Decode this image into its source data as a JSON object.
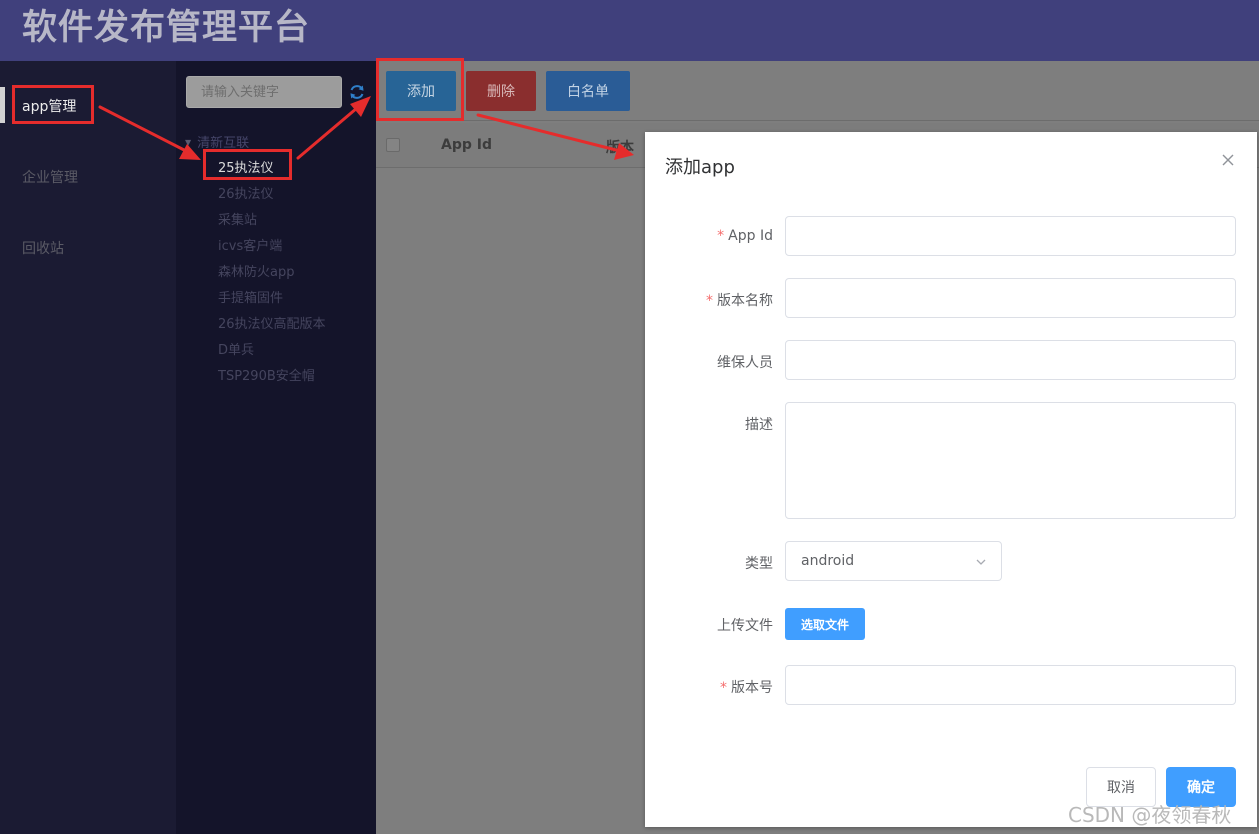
{
  "header": {
    "title": "软件发布管理平台"
  },
  "left_nav": {
    "items": [
      {
        "label": "app管理"
      },
      {
        "label": "企业管理"
      },
      {
        "label": "回收站"
      }
    ]
  },
  "tree": {
    "search_placeholder": "请输入关键字",
    "root_label": "清新互联",
    "items": [
      {
        "label": "25执法仪"
      },
      {
        "label": "26执法仪"
      },
      {
        "label": "采集站"
      },
      {
        "label": "icvs客户端"
      },
      {
        "label": "森林防火app"
      },
      {
        "label": "手提箱固件"
      },
      {
        "label": "26执法仪高配版本"
      },
      {
        "label": "D单兵"
      },
      {
        "label": "TSP290B安全帽"
      }
    ]
  },
  "toolbar": {
    "add_label": "添加",
    "delete_label": "删除",
    "whitelist_label": "白名单"
  },
  "table": {
    "columns": [
      "App Id",
      "版本"
    ]
  },
  "dialog": {
    "title": "添加app",
    "fields": {
      "app_id_label": "App Id",
      "version_name_label": "版本名称",
      "maintainer_label": "维保人员",
      "description_label": "描述",
      "type_label": "类型",
      "type_value": "android",
      "upload_label": "上传文件",
      "choose_file_label": "选取文件",
      "version_number_label": "版本号"
    },
    "cancel_label": "取消",
    "confirm_label": "确定"
  },
  "watermark": "CSDN @夜领春秋",
  "colors": {
    "header_bg": "#40407c",
    "annotation_red": "#e52c2c",
    "primary_blue": "#409eff",
    "required_star": "#f56c6c"
  }
}
